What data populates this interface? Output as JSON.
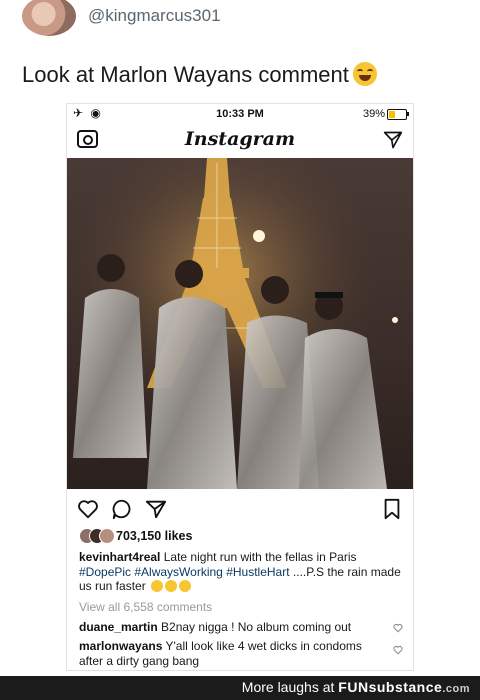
{
  "tweet": {
    "handle": "@kingmarcus301",
    "text": "Look at Marlon Wayans comment"
  },
  "status_bar": {
    "time": "10:33 PM",
    "battery": "39%",
    "battery_level": 0.39
  },
  "instagram": {
    "app_title": "Instagram",
    "likes": "703,150 likes",
    "caption": {
      "user": "kevinhart4real",
      "text": "Late night run with the fellas in Paris",
      "hashtags": [
        "#DopePic",
        "#AlwaysWorking",
        "#HustleHart"
      ],
      "text2": "....P.S the rain made us run faster"
    },
    "view_all": "View all 6,558 comments",
    "comments": [
      {
        "user": "duane_martin",
        "text": "B2nay nigga ! No album coming out"
      },
      {
        "user": "marlonwayans",
        "text": "Y'all look like 4 wet dicks in condoms after a dirty gang bang"
      }
    ]
  },
  "footer": {
    "prefix": "More laughs at",
    "brand_a": "FUN",
    "brand_b": "substance",
    "brand_c": ".com"
  },
  "colors": {
    "hashtag": "#0b3a66",
    "footer_bg": "#1b1b1b",
    "battery_fill": "#f2c200"
  },
  "icons": [
    "camera-icon",
    "direct-message-icon",
    "heart-icon",
    "comment-icon",
    "share-icon",
    "bookmark-icon",
    "airplane-icon",
    "wifi-icon"
  ]
}
